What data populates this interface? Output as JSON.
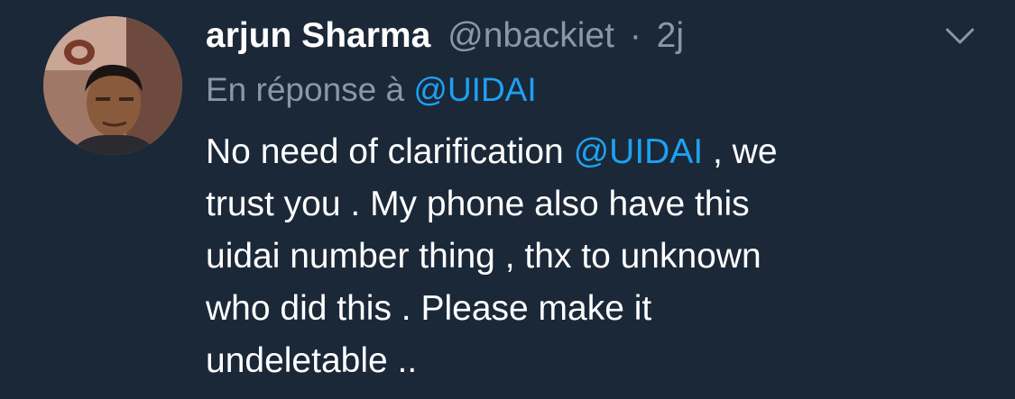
{
  "tweet": {
    "author_name": "arjun Sharma",
    "handle": "@nbackiet",
    "separator": "·",
    "time": "2j",
    "reply_prefix": "En réponse à",
    "reply_mention": "@UIDAI",
    "body": {
      "line1_before": "No need of clarification ",
      "line1_mention": "@UIDAI",
      "line1_after": " , we",
      "line2": "trust you . My phone also have this",
      "line3": "uidai number thing , thx to unknown",
      "line4": "who did this . Please make it",
      "line5": "undeletable .."
    }
  },
  "icons": {
    "menu": "chevron-down-icon",
    "avatar": "profile-photo"
  },
  "colors": {
    "background": "#1b2838",
    "text": "#ffffff",
    "muted": "#8899a6",
    "link": "#1da1f2"
  }
}
